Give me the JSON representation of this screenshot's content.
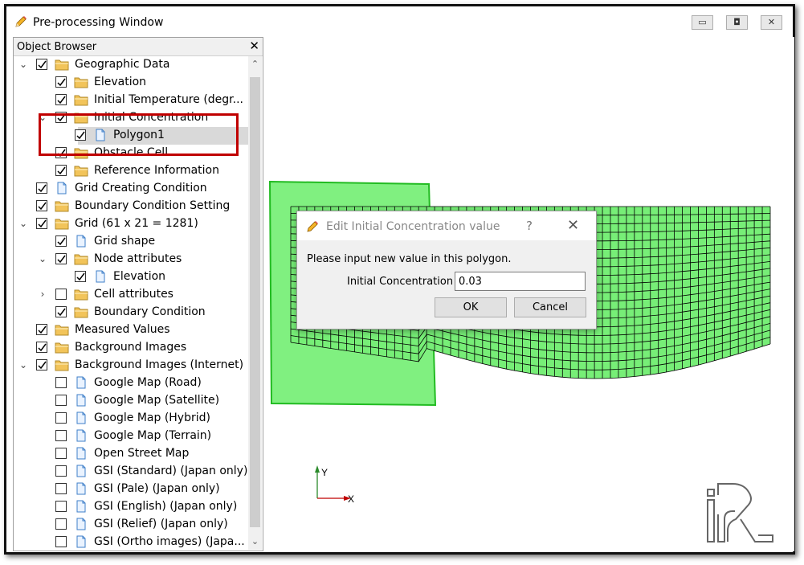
{
  "window": {
    "title": "Pre-processing Window",
    "controls": [
      "minimize",
      "restore",
      "close"
    ]
  },
  "object_browser": {
    "title": "Object Browser",
    "items": [
      {
        "label": "Geographic Data",
        "level": 0,
        "arrow": "expanded",
        "checked": true,
        "icon": "folder-icon"
      },
      {
        "label": "Elevation",
        "level": 1,
        "arrow": "none",
        "checked": true,
        "icon": "folder-icon"
      },
      {
        "label": "Initial Temperature (degr...",
        "level": 1,
        "arrow": "none",
        "checked": true,
        "icon": "folder-icon"
      },
      {
        "label": "Initial Concentration",
        "level": 1,
        "arrow": "expanded",
        "checked": true,
        "icon": "folder-icon"
      },
      {
        "label": "Polygon1",
        "level": 2,
        "arrow": "none",
        "checked": true,
        "icon": "document-icon",
        "selected": true
      },
      {
        "label": "Obstacle Cell",
        "level": 1,
        "arrow": "none",
        "checked": true,
        "icon": "folder-icon"
      },
      {
        "label": "Reference Information",
        "level": 1,
        "arrow": "none",
        "checked": true,
        "icon": "folder-icon"
      },
      {
        "label": "Grid Creating Condition",
        "level": 0,
        "arrow": "none",
        "checked": true,
        "icon": "document-icon"
      },
      {
        "label": "Boundary Condition Setting",
        "level": 0,
        "arrow": "none",
        "checked": true,
        "icon": "folder-icon"
      },
      {
        "label": "Grid (61 x 21 = 1281)",
        "level": 0,
        "arrow": "expanded",
        "checked": true,
        "icon": "folder-icon"
      },
      {
        "label": "Grid shape",
        "level": 1,
        "arrow": "none",
        "checked": true,
        "icon": "document-icon"
      },
      {
        "label": "Node attributes",
        "level": 1,
        "arrow": "expanded",
        "checked": true,
        "icon": "folder-icon"
      },
      {
        "label": "Elevation",
        "level": 2,
        "arrow": "none",
        "checked": true,
        "icon": "document-icon"
      },
      {
        "label": "Cell attributes",
        "level": 1,
        "arrow": "collapsed",
        "checked": false,
        "icon": "folder-icon"
      },
      {
        "label": "Boundary Condition",
        "level": 1,
        "arrow": "none",
        "checked": true,
        "icon": "folder-icon"
      },
      {
        "label": "Measured Values",
        "level": 0,
        "arrow": "none",
        "checked": true,
        "icon": "folder-icon"
      },
      {
        "label": "Background Images",
        "level": 0,
        "arrow": "none",
        "checked": true,
        "icon": "folder-icon"
      },
      {
        "label": "Background Images (Internet)",
        "level": 0,
        "arrow": "expanded",
        "checked": true,
        "icon": "folder-icon"
      },
      {
        "label": "Google Map (Road)",
        "level": 1,
        "arrow": "none",
        "checked": false,
        "icon": "document-icon"
      },
      {
        "label": "Google Map (Satellite)",
        "level": 1,
        "arrow": "none",
        "checked": false,
        "icon": "document-icon"
      },
      {
        "label": "Google Map (Hybrid)",
        "level": 1,
        "arrow": "none",
        "checked": false,
        "icon": "document-icon"
      },
      {
        "label": "Google Map (Terrain)",
        "level": 1,
        "arrow": "none",
        "checked": false,
        "icon": "document-icon"
      },
      {
        "label": "Open Street Map",
        "level": 1,
        "arrow": "none",
        "checked": false,
        "icon": "document-icon"
      },
      {
        "label": "GSI (Standard) (Japan only)",
        "level": 1,
        "arrow": "none",
        "checked": false,
        "icon": "document-icon"
      },
      {
        "label": "GSI (Pale) (Japan only)",
        "level": 1,
        "arrow": "none",
        "checked": false,
        "icon": "document-icon"
      },
      {
        "label": "GSI (English) (Japan only)",
        "level": 1,
        "arrow": "none",
        "checked": false,
        "icon": "document-icon"
      },
      {
        "label": "GSI (Relief) (Japan only)",
        "level": 1,
        "arrow": "none",
        "checked": false,
        "icon": "document-icon"
      },
      {
        "label": "GSI (Ortho images) (Japa...",
        "level": 1,
        "arrow": "none",
        "checked": false,
        "icon": "document-icon"
      }
    ]
  },
  "dialog": {
    "title": "Edit Initial Concentration value",
    "help": "?",
    "close": "✕",
    "message": "Please input new value in this polygon.",
    "field_label": "Initial Concentration :",
    "field_value": "0.03",
    "ok_label": "OK",
    "cancel_label": "Cancel"
  },
  "axes": {
    "y_label": "Y",
    "x_label": "X"
  },
  "grid": {
    "columns": 61,
    "rows": 21,
    "fill_color": "#77ee77",
    "line_color": "#000000"
  },
  "polygon": {
    "fill_color": "#80f080",
    "border_color": "#22bb22"
  },
  "logo_text": "iRIC",
  "colors": {
    "highlight_border": "#c00000",
    "selection": "#d9d9d9",
    "folder": "#f2c45a"
  }
}
